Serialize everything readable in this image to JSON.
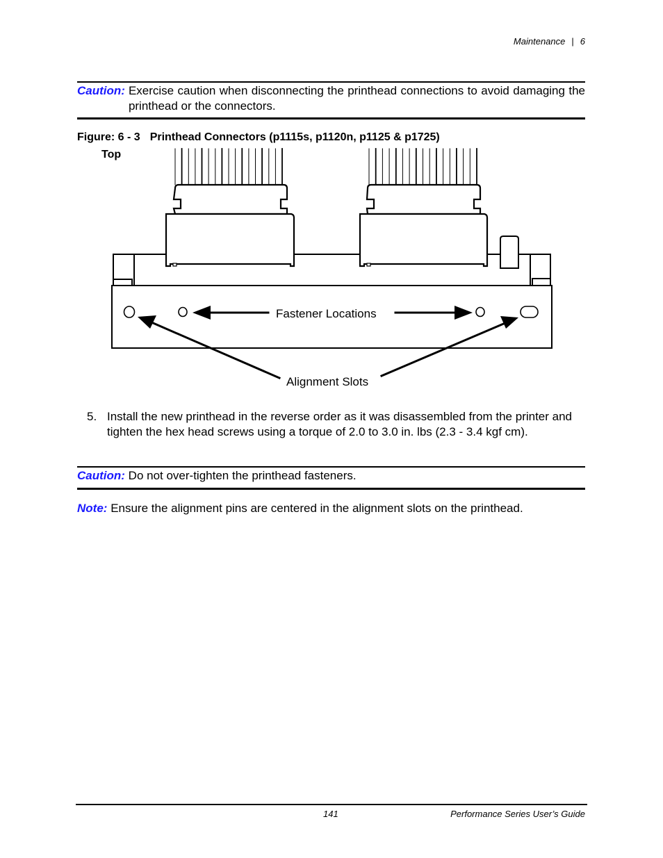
{
  "header": {
    "section": "Maintenance",
    "separator": "|",
    "chapter": "6"
  },
  "caution1": {
    "label": "Caution:",
    "text": "Exercise caution when disconnecting the printhead connections to avoid damaging the printhead or the connectors."
  },
  "figure": {
    "number": "Figure: 6 - 3",
    "title": "Printhead Connectors (p1115s, p1120n, p1125 & p1725)",
    "orientation_label": "Top",
    "callouts": {
      "fastener": "Fastener Locations",
      "alignment": "Alignment Slots"
    }
  },
  "step5": {
    "number": "5.",
    "text": "Install the new printhead in the reverse order as it was disassembled from the printer and tighten the hex head screws using a torque of 2.0 to 3.0 in. lbs (2.3 - 3.4 kgf cm)."
  },
  "caution2": {
    "label": "Caution:",
    "text": "Do not over-tighten the printhead fasteners."
  },
  "note": {
    "label": "Note:",
    "text": "Ensure the alignment pins are centered in the alignment slots on the printhead."
  },
  "footer": {
    "page_number": "141",
    "guide_title": "Performance Series User’s Guide"
  },
  "colors": {
    "label_accent": "#1a1aff",
    "text": "#000000"
  }
}
